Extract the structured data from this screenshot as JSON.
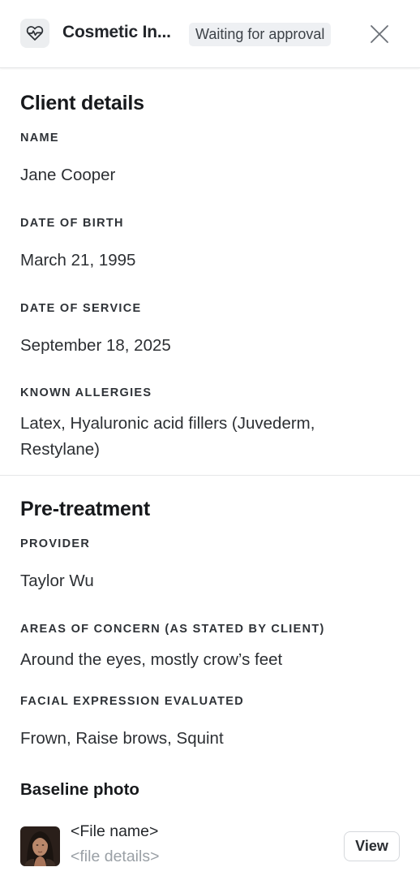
{
  "header": {
    "app_icon": "heart-pulse-icon",
    "title": "Cosmetic In...",
    "status": "Waiting for approval",
    "close_icon": "close-icon"
  },
  "client_details": {
    "title": "Client details",
    "name_label": "NAME",
    "name_value": "Jane Cooper",
    "dob_label": "DATE OF BIRTH",
    "dob_value": "March 21, 1995",
    "dos_label": "DATE OF SERVICE",
    "dos_value": "September 18, 2025",
    "allergies_label": "KNOWN ALLERGIES",
    "allergies_value": "Latex, Hyaluronic acid fillers (Juvederm, Restylane)"
  },
  "pre_treatment": {
    "title": "Pre-treatment",
    "provider_label": "PROVIDER",
    "provider_value": "Taylor Wu",
    "concern_label": "AREAS OF CONCERN (AS STATED BY CLIENT)",
    "concern_value": "Around the eyes, mostly crow’s feet",
    "expression_label": "FACIAL EXPRESSION EVALUATED",
    "expression_value": "Frown, Raise brows, Squint",
    "baseline_photo": {
      "title": "Baseline photo",
      "file_name": "<File name>",
      "file_details": "<file details>",
      "view_label": "View"
    }
  }
}
